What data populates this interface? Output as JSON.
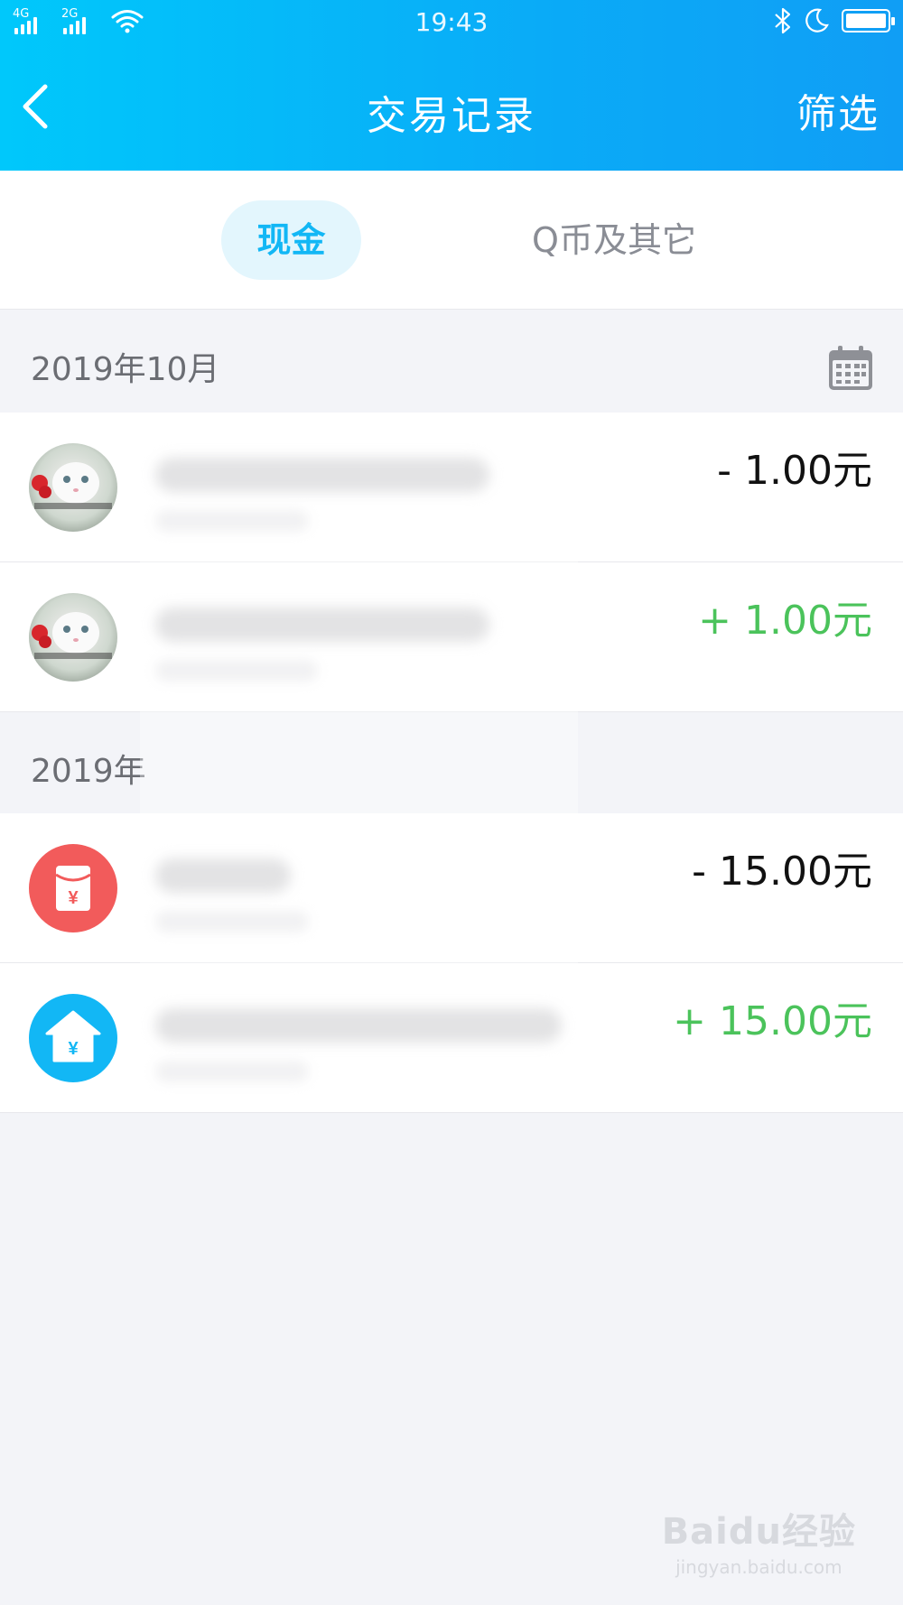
{
  "status_bar": {
    "time": "19:43",
    "signal_1_label": "4G",
    "signal_2_label": "2G"
  },
  "header": {
    "title": "交易记录",
    "filter_label": "筛选"
  },
  "tabs": [
    {
      "label": "现金",
      "selected": true
    },
    {
      "label": "Q币及其它",
      "selected": false
    }
  ],
  "sections": [
    {
      "date": "2019年10月",
      "rows": [
        {
          "avatar": "cat-photo-avatar",
          "amount": "- 1.00元",
          "kind": "expense"
        },
        {
          "avatar": "cat-photo-avatar",
          "amount": "+ 1.00元",
          "kind": "income"
        }
      ]
    },
    {
      "date": "2019年",
      "rows": [
        {
          "avatar": "red-packet-icon",
          "amount": "- 15.00元",
          "kind": "expense"
        },
        {
          "avatar": "home-yuan-icon",
          "amount": "+ 15.00元",
          "kind": "income"
        }
      ]
    }
  ],
  "colors": {
    "header_gradient_start": "#00c8fb",
    "header_gradient_end": "#109ef5",
    "tab_selected_text": "#12b7f5",
    "income": "#4bc35b",
    "expense": "#111111",
    "red_packet": "#f25b5b",
    "home_icon": "#12b7f5"
  },
  "watermark": {
    "brand": "Baidu经验",
    "url": "jingyan.baidu.com"
  }
}
